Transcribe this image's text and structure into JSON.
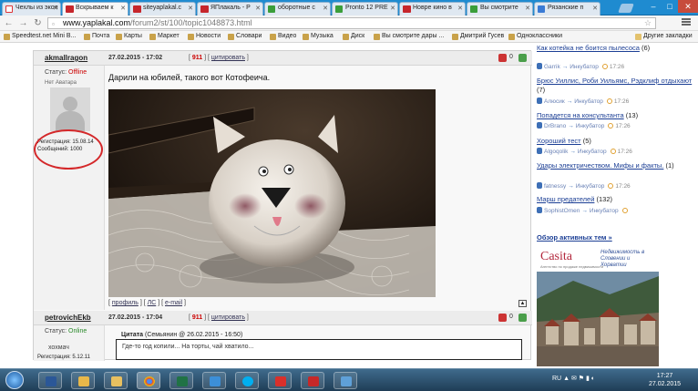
{
  "tabs": [
    {
      "title": "Чехлы из экол",
      "favicon": "yan"
    },
    {
      "title": "Вскрываем к",
      "favicon": "yap",
      "active": true
    },
    {
      "title": "siteyaplakal.c",
      "favicon": "yap"
    },
    {
      "title": "ЯПлакаль - Р",
      "favicon": "yap"
    },
    {
      "title": "оборотные с",
      "favicon": "green"
    },
    {
      "title": "Pronto 12 PRE",
      "favicon": "green"
    },
    {
      "title": "Новре кино в",
      "favicon": "yap"
    },
    {
      "title": "Вы смотрите",
      "favicon": "green"
    },
    {
      "title": "Рязанские п",
      "favicon": "blue"
    }
  ],
  "window": {
    "minimize": "–",
    "maximize": "□",
    "close": "✕"
  },
  "address": {
    "domain": "www.yaplakal.com",
    "path": "/forum2/st/100/topic1048873.html"
  },
  "bookmarks": [
    {
      "label": "Speedtest.net Mini B..."
    },
    {
      "label": "Почта"
    },
    {
      "label": "Карты"
    },
    {
      "label": "Маркет"
    },
    {
      "label": "Новости"
    },
    {
      "label": "Словари"
    },
    {
      "label": "Видео"
    },
    {
      "label": "Музыка"
    },
    {
      "label": "Диск"
    },
    {
      "label": "Вы смотрите дары ..."
    },
    {
      "label": "Дмитрий Гусев"
    },
    {
      "label": "Одноклассники"
    },
    {
      "label": "Другие закладки"
    }
  ],
  "post1": {
    "author": "akmallragon",
    "date": "27.02.2015 - 17:02",
    "num": "911",
    "quote_link": "цитировать",
    "status_label": "Статус:",
    "status_value": "Offline",
    "no_avatar": "Нет Аватара",
    "reg_line": "Регистрация: 15.08.14",
    "msg_line": "Сообщений: 1000",
    "text": "Дарили на юбилей, такого вот Котофеича.",
    "footer_profile": "профиль",
    "footer_pm": "ЛС",
    "footer_email": "e-mail",
    "rating": "0"
  },
  "post2": {
    "author": "petrovichEkb",
    "date": "27.02.2015 - 17:04",
    "num": "911",
    "quote_link": "цитировать",
    "status_label": "Статус:",
    "status_value": "Online",
    "rank": "хохмач",
    "reg_line": "Регистрация: 5.12.11",
    "quote_title": "Цитата",
    "quote_meta": "(Семьянин @ 26.02.2015 - 16:50)",
    "quote_text": "Где-то год копили... На торты, чай хватило...",
    "rating": "0"
  },
  "sidebar": {
    "items": [
      {
        "title": "Как котейка не боится пылесоса",
        "count": "(6)",
        "author": "Garrik",
        "section": "Инкубатор",
        "time": "17:26"
      },
      {
        "title": "Брюс Уиллис, Роби Уильямс, Рэдклиф отдыхают",
        "count": "(7)",
        "author": "Алюсик",
        "section": "Инкубатор",
        "time": "17:26"
      },
      {
        "title": "Попадется на консультанта",
        "count": "(13)",
        "author": "DrBrano",
        "section": "Инкубатор",
        "time": "17:26"
      },
      {
        "title": "Хороший тест",
        "count": "(5)",
        "author": "Algoqolik",
        "section": "Инкубатор",
        "time": "17:26"
      },
      {
        "title": "Удары электричеством. Мифы и факты.",
        "count": "(1)",
        "author": "fatnessy",
        "section": "Инкубатор",
        "time": "17:26"
      },
      {
        "title": "Марш предателей",
        "count": "(132)",
        "author": "SophistOmen",
        "section": "Инкубатор",
        "time": ""
      }
    ],
    "overview": "Обзор активных тем »",
    "ad_brand": "Casita",
    "ad_tag": "Агентство по продаже недвижимости",
    "ad_text": "Недвижимость в Словении и Хорватии"
  },
  "taskbar": {
    "lang": "RU",
    "time": "17:27",
    "date": "27.02.2015"
  }
}
